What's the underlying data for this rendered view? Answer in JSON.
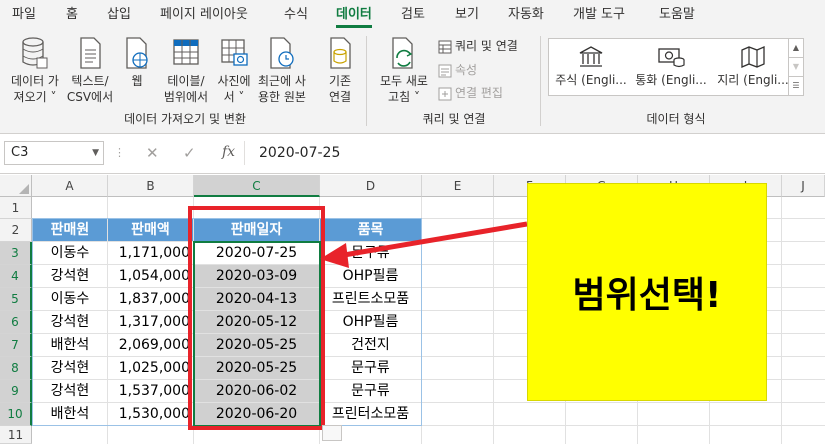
{
  "menu": {
    "tabs": [
      "파일",
      "홈",
      "삽입",
      "페이지 레이아웃",
      "수식",
      "데이터",
      "검토",
      "보기",
      "자동화",
      "개발 도구",
      "도움말"
    ],
    "active": "데이터"
  },
  "ribbon": {
    "get_data": {
      "line1": "데이터 가",
      "line2": "져오기 ˅"
    },
    "from_text": {
      "line1": "텍스트/",
      "line2": "CSV에서"
    },
    "from_web": {
      "line1": "웹"
    },
    "from_table": {
      "line1": "테이블/",
      "line2": "범위에서"
    },
    "from_picture": {
      "line1": "사진에",
      "line2": "서 ˅"
    },
    "recent_sources": {
      "line1": "최근에 사",
      "line2": "용한 원본"
    },
    "existing_conn": {
      "line1": "기존",
      "line2": "연결"
    },
    "group_get_data": "데이터 가져오기 및 변환",
    "refresh_all": {
      "line1": "모두 새로",
      "line2": "고침 ˅"
    },
    "queries_connections": "쿼리 및 연결",
    "properties": "속성",
    "edit_links": "연결 편집",
    "group_queries": "쿼리 및 연결",
    "data_types": [
      "주식 (Engli...",
      "통화 (Engli...",
      "지리 (Engli..."
    ],
    "group_data_types": "데이터 형식"
  },
  "formula_bar": {
    "name_box": "C3",
    "cancel": "✕",
    "confirm": "✓",
    "fx": "fx",
    "value": "2020-07-25"
  },
  "sheet": {
    "columns": [
      "A",
      "B",
      "C",
      "D",
      "E",
      "F",
      "G",
      "H",
      "I",
      "J"
    ],
    "rows": [
      "1",
      "2",
      "3",
      "4",
      "5",
      "6",
      "7",
      "8",
      "9",
      "10",
      "11"
    ],
    "table_headers": [
      "판매원",
      "판매액",
      "판매일자",
      "품목"
    ],
    "table_rows": [
      [
        "이동수",
        "1,171,000",
        "2020-07-25",
        "문구류"
      ],
      [
        "강석현",
        "1,054,000",
        "2020-03-09",
        "OHP필름"
      ],
      [
        "이동수",
        "1,837,000",
        "2020-04-13",
        "프린트소모품"
      ],
      [
        "강석현",
        "1,317,000",
        "2020-05-12",
        "OHP필름"
      ],
      [
        "배한석",
        "2,069,000",
        "2020-05-25",
        "건전지"
      ],
      [
        "강석현",
        "1,025,000",
        "2020-05-25",
        "문구류"
      ],
      [
        "강석현",
        "1,537,000",
        "2020-06-02",
        "문구류"
      ],
      [
        "배한석",
        "1,530,000",
        "2020-06-20",
        "프린터소모품"
      ]
    ]
  },
  "annotation": {
    "callout_text": "범위선택!",
    "callout_color": "#ffff00",
    "highlight_color": "#e8232a"
  },
  "colors": {
    "accent": "#107c41",
    "table_header": "#5b9bd5"
  }
}
